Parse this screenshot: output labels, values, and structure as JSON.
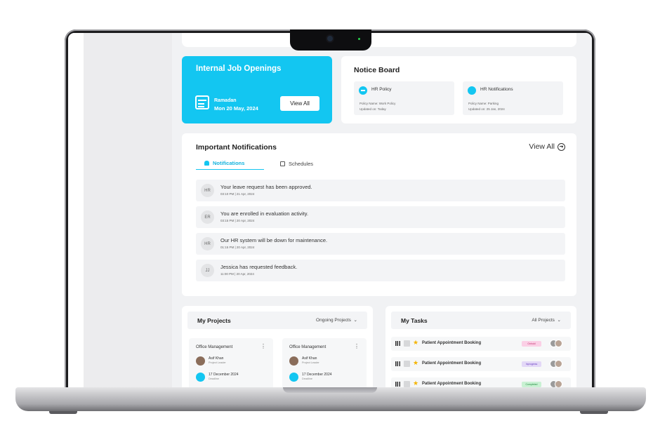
{
  "job_openings": {
    "title": "Internal Job Openings",
    "event": "Ramadan",
    "date": "Mon 20 May, 2024",
    "view_all": "View All"
  },
  "notice_board": {
    "title": "Notice Board",
    "items": [
      {
        "label": "HR Policy",
        "line1": "Policy Name: Work Policy",
        "line2": "Updated on: Today"
      },
      {
        "label": "HR Notifications",
        "line1": "Policy Name: Parking",
        "line2": "Updated on: 25 Jan, 2024"
      }
    ]
  },
  "notifications": {
    "title": "Important Notifications",
    "view_all": "View All",
    "tabs": [
      "Notifications",
      "Schedules"
    ],
    "items": [
      {
        "initials": "HR",
        "text": "Your leave request has been approved.",
        "time": "03:10 PM | 21 Apr, 2024"
      },
      {
        "initials": "ER",
        "text": "You are enrolled in evaluation activity.",
        "time": "03:15 PM | 20 Apr, 2024"
      },
      {
        "initials": "HR",
        "text": "Our HR system will be down for maintenance.",
        "time": "01:15 PM | 20 Apr, 2024"
      },
      {
        "initials": "JJ",
        "text": "Jessica has requested feedback.",
        "time": "11:00 PM | 20 Apr, 2024"
      }
    ]
  },
  "projects": {
    "title": "My Projects",
    "filter": "Ongoing Projects",
    "items": [
      {
        "name": "Office Management",
        "person": "Asif Khan",
        "role": "Project Leader",
        "deadline": "17 December 2024",
        "deadline_label": "Deadline"
      },
      {
        "name": "Office Management",
        "person": "Asif Khan",
        "role": "Project Leader",
        "deadline": "17 December 2024",
        "deadline_label": "Deadline"
      }
    ]
  },
  "tasks": {
    "title": "My Tasks",
    "filter": "All Projects",
    "items": [
      {
        "name": "Patient Appointment Booking",
        "status": "Onhold",
        "status_bg": "#fbd0e6",
        "status_fg": "#c2336f"
      },
      {
        "name": "Patient Appointment Booking",
        "status": "Inprogress",
        "status_bg": "#e3d8f7",
        "status_fg": "#6a3fc0"
      },
      {
        "name": "Patient Appointment Booking",
        "status": "Completed",
        "status_bg": "#c9f1d3",
        "status_fg": "#1f8a3d"
      }
    ]
  },
  "colors": {
    "accent": "#13c6f1"
  },
  "icons": [
    "calendar-icon",
    "bell-icon",
    "schedule-icon",
    "circle-arrow-icon",
    "chevron-down-icon",
    "kebab-menu-icon",
    "grid-drag-icon",
    "star-icon"
  ]
}
